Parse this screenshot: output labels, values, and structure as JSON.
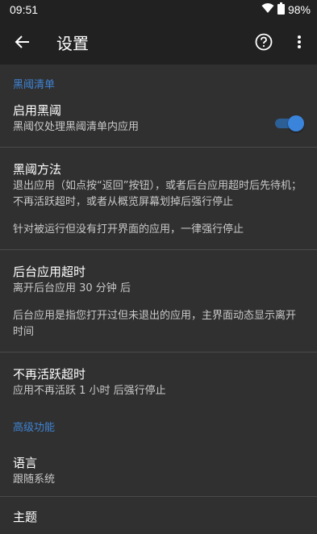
{
  "status_bar": {
    "time": "09:51",
    "battery": "98%"
  },
  "app_bar": {
    "title": "设置"
  },
  "sections": {
    "blacklist_header": "黑阈清单",
    "advanced_header": "高级功能"
  },
  "prefs": {
    "enable": {
      "title": "启用黑阈",
      "summary": "黑阈仅处理黑阈清单内应用",
      "toggle_on": true
    },
    "method": {
      "title": "黑阈方法",
      "summary": "退出应用（如点按“返回”按钮），或者后台应用超时后先待机；不再活跃超时，或者从概览屏幕划掉后强行停止",
      "extra": "针对被运行但没有打开界面的应用，一律强行停止"
    },
    "bg_timeout": {
      "title": "后台应用超时",
      "summary": "离开后台应用 30 分钟 后",
      "extra": "后台应用是指您打开过但未退出的应用，主界面动态显示离开时间"
    },
    "inactive_timeout": {
      "title": "不再活跃超时",
      "summary": "应用不再活跃 1 小时 后强行停止"
    },
    "language": {
      "title": "语言",
      "summary": "跟随系统"
    },
    "theme": {
      "title": "主题"
    }
  },
  "colors": {
    "accent": "#3f83d4",
    "background": "#303030",
    "bar": "#212121"
  }
}
